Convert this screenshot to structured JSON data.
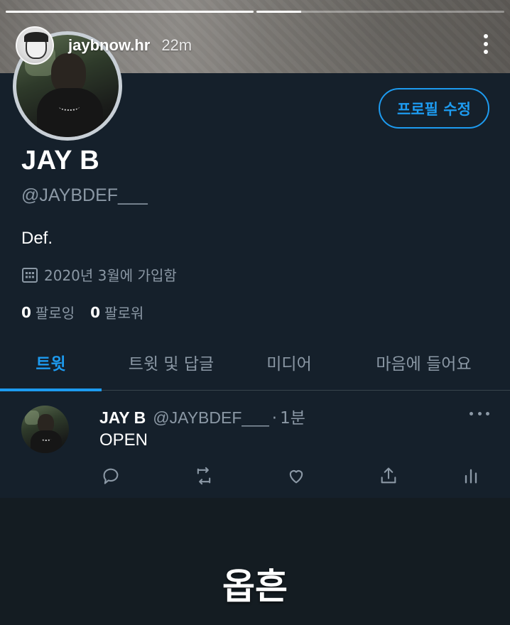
{
  "story": {
    "username": "jaybnow.hr",
    "time": "22m",
    "progress": [
      1.0,
      0.18
    ]
  },
  "profile": {
    "edit_button_label": "프로필 수정",
    "display_name": "JAY B",
    "handle": "@JAYBDEF___",
    "bio": "Def.",
    "joined": "2020년 3월에 가입함",
    "following_count": "0",
    "following_label": "팔로잉",
    "followers_count": "0",
    "followers_label": "팔로워"
  },
  "tabs": [
    {
      "label": "트윗",
      "active": true
    },
    {
      "label": "트윗 및 답글",
      "active": false
    },
    {
      "label": "미디어",
      "active": false
    },
    {
      "label": "마음에 들어요",
      "active": false
    }
  ],
  "tweet": {
    "name": "JAY B",
    "handle": "@JAYBDEF___",
    "separator": "·",
    "time": "1분",
    "text": "OPEN"
  },
  "caption": "옵흔",
  "colors": {
    "background": "#15202b",
    "accent": "#1d9bf0",
    "secondary_text": "#8b98a5"
  }
}
